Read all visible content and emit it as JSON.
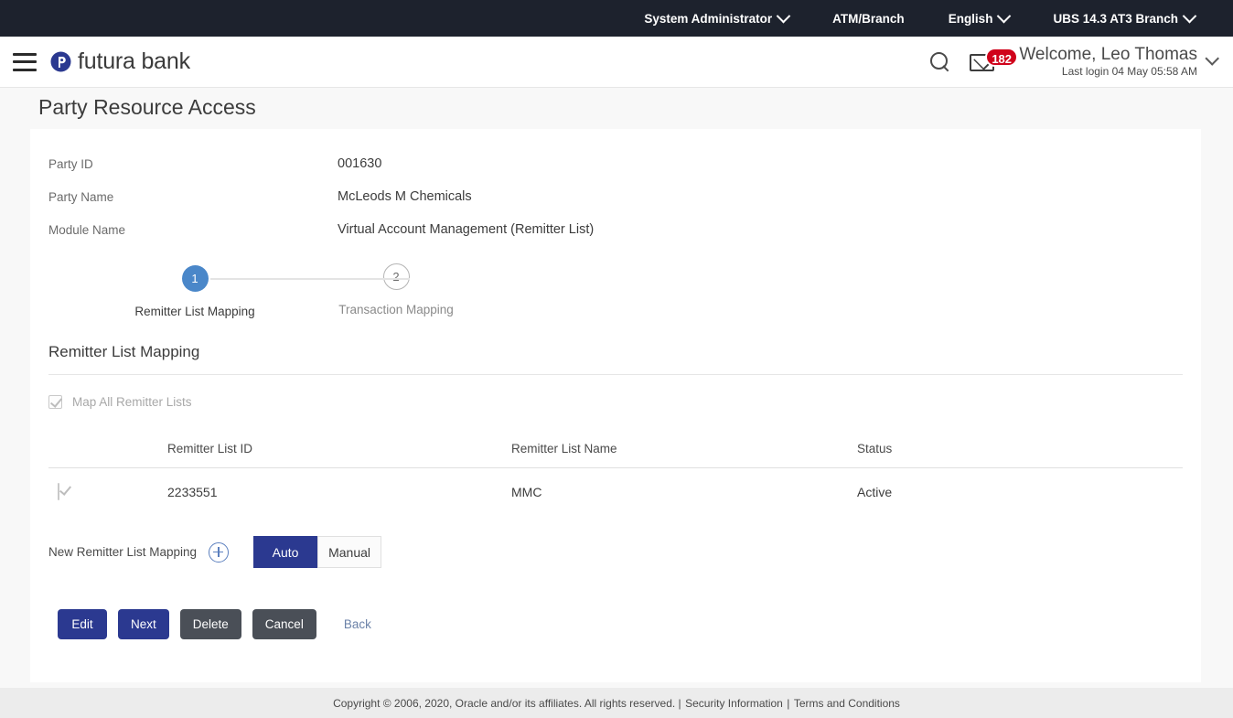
{
  "topbar": {
    "items": [
      {
        "label": "System Administrator",
        "has_chevron": true,
        "icon": "chevron-down-icon"
      },
      {
        "label": "ATM/Branch",
        "has_chevron": false,
        "icon": ""
      },
      {
        "label": "English",
        "has_chevron": true,
        "icon": "chevron-down-icon"
      },
      {
        "label": "UBS 14.3 AT3 Branch",
        "has_chevron": true,
        "icon": "chevron-down-icon"
      }
    ]
  },
  "header": {
    "menu_icon": "hamburger-icon",
    "brand_name": "futura bank",
    "brand_mark_icon": "futura-logo-icon",
    "search_icon": "search-icon",
    "mail_icon": "mail-icon",
    "mail_badge": "182",
    "welcome": "Welcome, Leo Thomas",
    "last_login": "Last login 04 May 05:58 AM",
    "profile_chevron_icon": "chevron-down-icon"
  },
  "page": {
    "title": "Party Resource Access"
  },
  "details": [
    {
      "label": "Party ID",
      "value": "001630"
    },
    {
      "label": "Party Name",
      "value": "McLeods M Chemicals"
    },
    {
      "label": "Module Name",
      "value": "Virtual Account Management (Remitter List)"
    }
  ],
  "stepper": {
    "steps": [
      {
        "number": "1",
        "label": "Remitter List Mapping",
        "state": "active"
      },
      {
        "number": "2",
        "label": "Transaction Mapping",
        "state": "inactive"
      }
    ]
  },
  "section": {
    "title": "Remitter List Mapping",
    "map_all_label": "Map All Remitter Lists",
    "map_all_checked": true
  },
  "table": {
    "columns": [
      "Remitter List ID",
      "Remitter List Name",
      "Status"
    ],
    "rows": [
      {
        "checked": true,
        "id": "2233551",
        "name": "MMC",
        "status": "Active"
      }
    ]
  },
  "new_mapping": {
    "label": "New Remitter List Mapping",
    "add_icon": "plus-circle-icon",
    "options": [
      "Auto",
      "Manual"
    ],
    "selected": "Auto"
  },
  "actions": {
    "buttons": [
      {
        "label": "Edit",
        "style": "primary"
      },
      {
        "label": "Next",
        "style": "primary"
      },
      {
        "label": "Delete",
        "style": "secondary"
      },
      {
        "label": "Cancel",
        "style": "secondary"
      },
      {
        "label": "Back",
        "style": "link"
      }
    ]
  },
  "footer": {
    "copyright": "Copyright © 2006, 2020, Oracle and/or its affiliates. All rights reserved. |",
    "security_link": "Security Information",
    "separator": "|",
    "terms_link": "Terms and Conditions"
  },
  "colors": {
    "topbar_bg": "#1d222d",
    "primary": "#2b3990",
    "secondary": "#4a4f57",
    "step_active": "#4a87c9",
    "badge_red": "#d0021b",
    "link": "#6b82a8"
  }
}
